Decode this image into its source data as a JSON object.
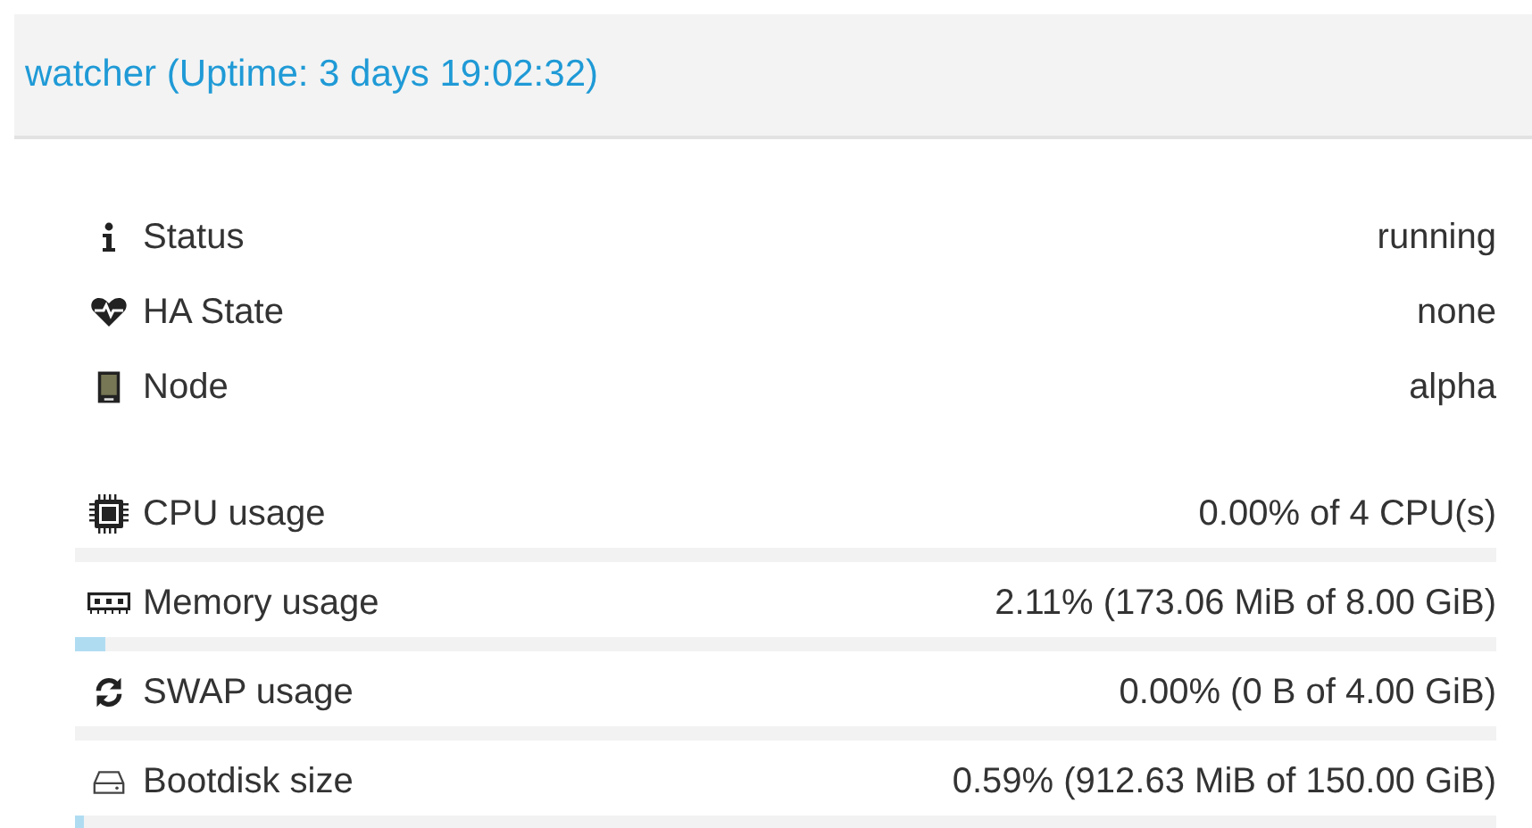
{
  "header": {
    "title": "watcher (Uptime: 3 days 19:02:32)"
  },
  "rows": [
    {
      "kind": "info",
      "label": "Status",
      "value": "running"
    },
    {
      "kind": "info",
      "label": "HA State",
      "value": "none"
    },
    {
      "kind": "info",
      "label": "Node",
      "value": "alpha"
    },
    {
      "kind": "usage",
      "label": "CPU usage",
      "value": "0.00% of 4 CPU(s)",
      "level": 0
    },
    {
      "kind": "usage",
      "label": "Memory usage",
      "value": "2.11% (173.06 MiB of 8.00 GiB)",
      "level": 0.0211
    },
    {
      "kind": "usage",
      "label": "SWAP usage",
      "value": "0.00% (0 B of 4.00 GiB)",
      "level": 0
    },
    {
      "kind": "usage",
      "label": "Bootdisk size",
      "value": "0.59% (912.63 MiB of 150.00 GiB)",
      "level": 0.0059
    }
  ]
}
